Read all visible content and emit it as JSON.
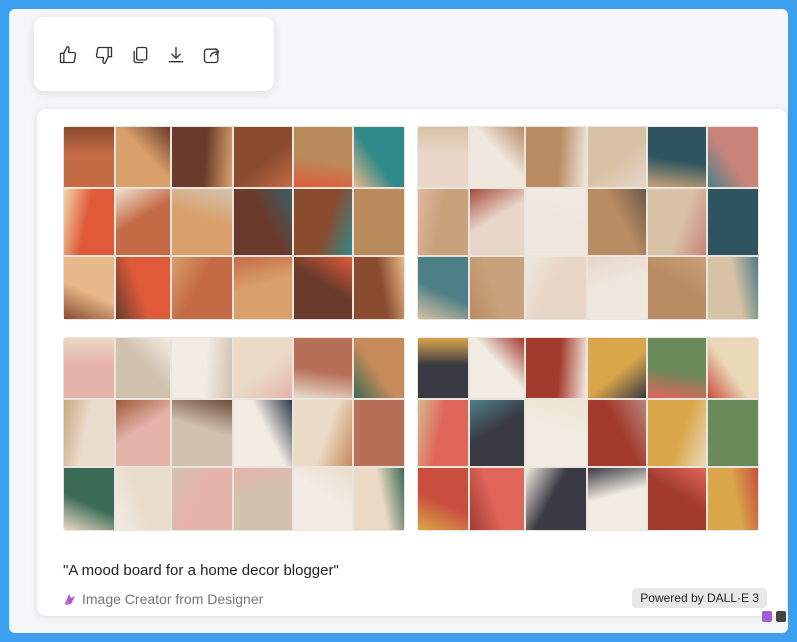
{
  "toolbar": {
    "buttons": [
      {
        "name": "like-button",
        "icon": "thumbs-up-icon"
      },
      {
        "name": "dislike-button",
        "icon": "thumbs-down-icon"
      },
      {
        "name": "copy-button",
        "icon": "copy-icon"
      },
      {
        "name": "download-button",
        "icon": "download-icon"
      },
      {
        "name": "share-button",
        "icon": "share-icon"
      }
    ]
  },
  "result": {
    "prompt": "\"A mood board for a home decor blogger\"",
    "source": "Image Creator from Designer",
    "source_icon": "designer-logo-icon",
    "powered_by": "Powered by DALL·E 3"
  },
  "images": [
    {
      "name": "generated-image-1",
      "palette": [
        "#c46a45",
        "#2f8a8a",
        "#e7b88a",
        "#8a4b2e",
        "#f0e2cf",
        "#d9a06b",
        "#3a5f6b",
        "#e05a3a",
        "#b98a5a",
        "#f4d6a8",
        "#6a3b2a",
        "#d4c3b0"
      ]
    },
    {
      "name": "generated-image-2",
      "palette": [
        "#e8d6c8",
        "#c9847a",
        "#4d7f86",
        "#d8c2a6",
        "#a64a3a",
        "#efe7de",
        "#6b5a4a",
        "#c7a27a",
        "#2f5560",
        "#e3b7a0",
        "#b98c64",
        "#f2ebe3"
      ]
    },
    {
      "name": "generated-image-3",
      "palette": [
        "#e6b3aa",
        "#c78a5a",
        "#3b6a55",
        "#ead9c4",
        "#9c5a3c",
        "#d1c2b0",
        "#2e3a4a",
        "#e9dccd",
        "#b76f58",
        "#c9a87e",
        "#f3ece4",
        "#6e4e3a"
      ]
    },
    {
      "name": "generated-image-4",
      "palette": [
        "#3a3a44",
        "#e9d9b8",
        "#c94e3e",
        "#d9a64a",
        "#4f7f8a",
        "#f2ece2",
        "#b9847a",
        "#e0665a",
        "#6b8a5a",
        "#d8b890",
        "#a33a2e",
        "#efe2d0"
      ]
    }
  ],
  "colors": {
    "background": "#3d9ff0",
    "page": "#f6f6f8",
    "card": "#ffffff",
    "designer_purple": "#a35bd6"
  }
}
